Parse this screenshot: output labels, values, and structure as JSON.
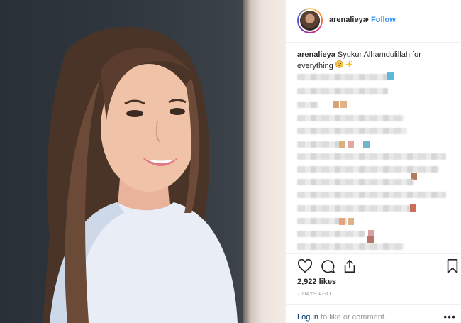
{
  "post": {
    "username": "arenalieya",
    "separator": "•",
    "follow_label": "Follow",
    "caption_user": "arenalieya",
    "caption_text": "Syukur Alhamdulillah for everything",
    "caption_emojis": [
      "grinning-face-emoji",
      "sparkles-emoji"
    ],
    "likes": "2,922 likes",
    "time_ago": "7 DAYS AGO",
    "login_link": "Log in",
    "login_rest": " to like or comment.",
    "more_label": "•••"
  },
  "icons": {
    "like": "heart-icon",
    "comment": "comment-bubble-icon",
    "share": "share-upload-icon",
    "save": "bookmark-icon",
    "more": "more-options-icon"
  },
  "colors": {
    "follow": "#3897f0",
    "link": "#003569",
    "meta": "#999999",
    "text": "#262626",
    "border": "#efefef"
  }
}
